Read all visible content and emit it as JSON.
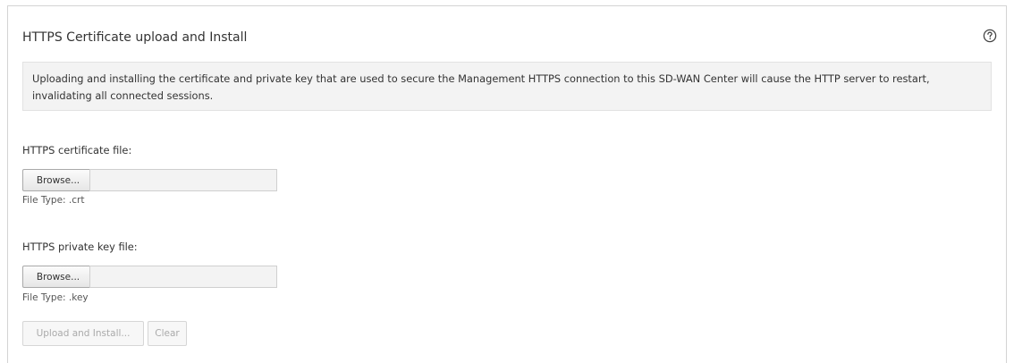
{
  "section": {
    "title": "HTTPS Certificate upload and Install",
    "help_icon": "help-circle-icon",
    "notice": "Uploading and installing the certificate and private key that are used to secure the Management HTTPS connection to this SD-WAN Center will cause the HTTP server to restart, invalidating all connected sessions."
  },
  "certificate": {
    "label": "HTTPS certificate file:",
    "browse_label": "Browse...",
    "file_value": "",
    "file_type": "File Type: .crt"
  },
  "private_key": {
    "label": "HTTPS private key file:",
    "browse_label": "Browse...",
    "file_value": "",
    "file_type": "File Type: .key"
  },
  "actions": {
    "upload_label": "Upload and Install...",
    "clear_label": "Clear"
  }
}
